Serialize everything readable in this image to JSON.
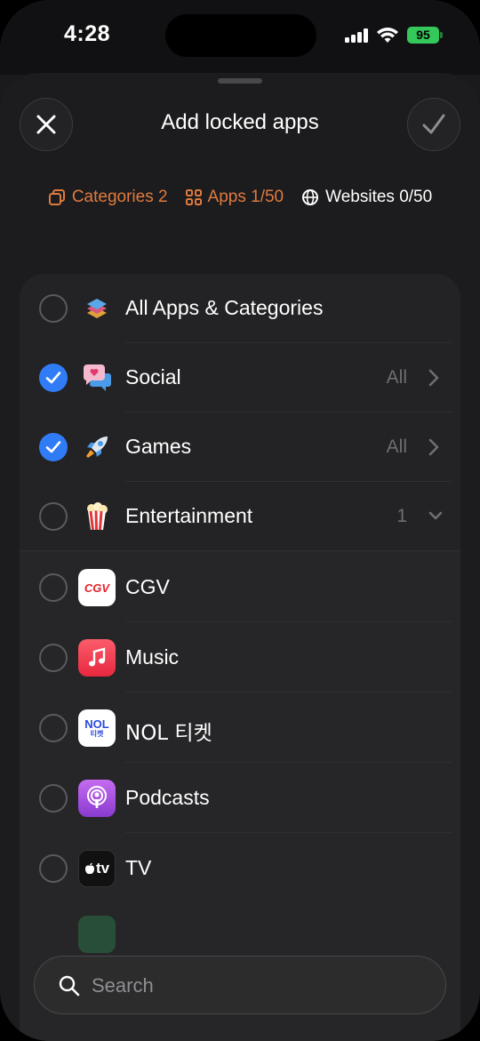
{
  "status_bar": {
    "time": "4:28",
    "battery": "95"
  },
  "sheet": {
    "title": "Add locked apps"
  },
  "counts": {
    "categories": "Categories 2",
    "apps": "Apps 1/50",
    "websites": "Websites 0/50"
  },
  "colors": {
    "accent_orange": "#e07a3e",
    "check_blue": "#2f7cf6",
    "battery_green": "#34c759"
  },
  "list": {
    "rows": [
      {
        "label": "All Apps & Categories",
        "icon": "layers-icon",
        "checked": false
      },
      {
        "label": "Social",
        "icon": "chat-heart-icon",
        "checked": true,
        "detail": "All"
      },
      {
        "label": "Games",
        "icon": "rocket-icon",
        "checked": true,
        "detail": "All"
      },
      {
        "label": "Entertainment",
        "icon": "popcorn-icon",
        "checked": false,
        "detail": "1"
      },
      {
        "label": "CGV",
        "icon": "cgv-app-icon",
        "checked": false,
        "icon_text": "CGV"
      },
      {
        "label": "Music",
        "icon": "music-app-icon",
        "checked": false
      },
      {
        "label": "NOL 티켓",
        "icon": "nol-app-icon",
        "checked": false,
        "icon_text": "NOL",
        "icon_subtext": "티켓"
      },
      {
        "label": "Podcasts",
        "icon": "podcasts-app-icon",
        "checked": false
      },
      {
        "label": "TV",
        "icon": "tv-app-icon",
        "checked": false,
        "icon_text": "tv"
      }
    ]
  },
  "search": {
    "placeholder": "Search"
  }
}
